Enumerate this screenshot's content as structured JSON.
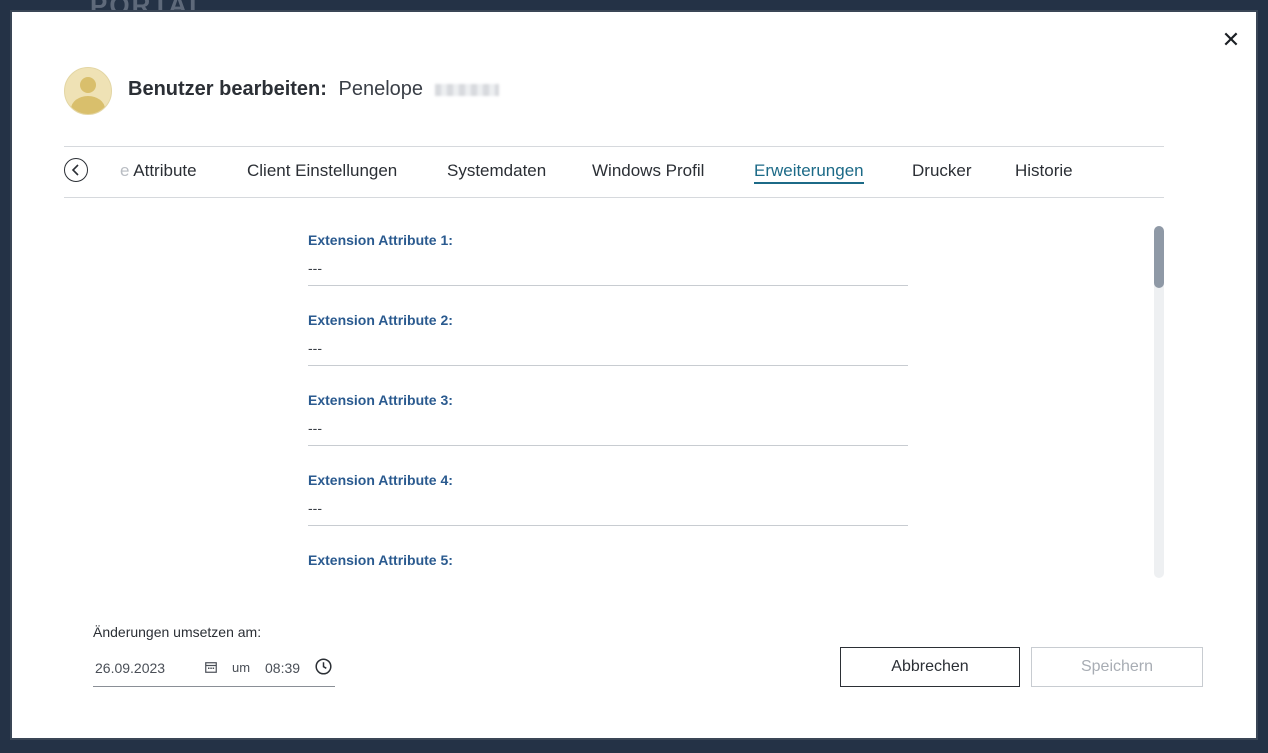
{
  "background": {
    "portal_text": "PORTAL"
  },
  "header": {
    "title_label": "Benutzer bearbeiten:",
    "user_name": "Penelope"
  },
  "close_icon": "close-icon",
  "tabs": [
    {
      "label": "Attribute",
      "partial_prefix": "e",
      "active": false
    },
    {
      "label": "Client Einstellungen",
      "active": false
    },
    {
      "label": "Systemdaten",
      "active": false
    },
    {
      "label": "Windows Profil",
      "active": false
    },
    {
      "label": "Erweiterungen",
      "active": true
    },
    {
      "label": "Drucker",
      "active": false
    },
    {
      "label": "Historie",
      "active": false
    }
  ],
  "fields": [
    {
      "label": "Extension Attribute 1:",
      "value": "---"
    },
    {
      "label": "Extension Attribute 2:",
      "value": "---"
    },
    {
      "label": "Extension Attribute 3:",
      "value": "---"
    },
    {
      "label": "Extension Attribute 4:",
      "value": "---"
    },
    {
      "label": "Extension Attribute 5:",
      "value": ""
    }
  ],
  "footer": {
    "apply_label": "Änderungen umsetzen am:",
    "date": "26.09.2023",
    "um": "um",
    "time": "08:39",
    "cancel_label": "Abbrechen",
    "save_label": "Speichern"
  },
  "colors": {
    "accent": "#1c6a87",
    "field_label": "#2a5a8f",
    "text": "#2b2f35"
  }
}
